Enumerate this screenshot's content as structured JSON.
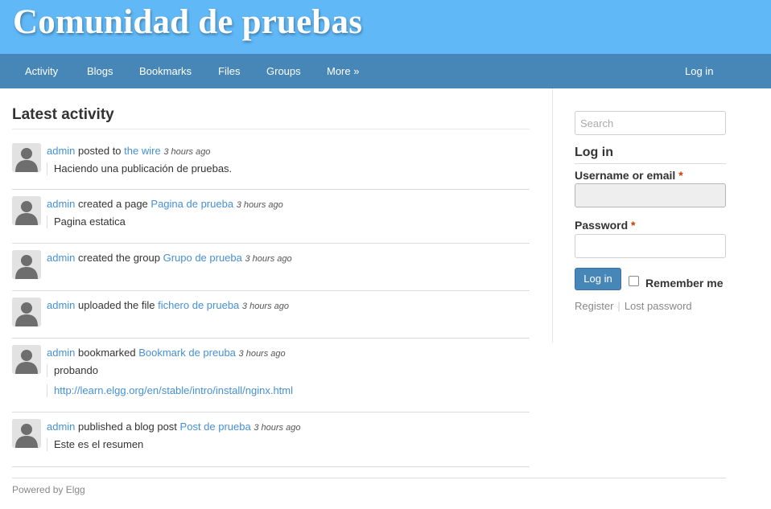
{
  "site": {
    "title": "Comunidad de pruebas"
  },
  "nav": {
    "items": [
      "Activity",
      "Blogs",
      "Bookmarks",
      "Files",
      "Groups",
      "More »"
    ],
    "login": "Log in"
  },
  "main": {
    "heading": "Latest activity"
  },
  "activity": [
    {
      "user": "admin",
      "action": "posted to",
      "target": "the wire",
      "time": "3 hours ago",
      "excerpt": "Haciendo una publicación de pruebas.",
      "link": ""
    },
    {
      "user": "admin",
      "action": "created a page",
      "target": "Pagina de prueba",
      "time": "3 hours ago",
      "excerpt": "Pagina estatica",
      "link": ""
    },
    {
      "user": "admin",
      "action": "created the group",
      "target": "Grupo de prueba",
      "time": "3 hours ago",
      "excerpt": "",
      "link": ""
    },
    {
      "user": "admin",
      "action": "uploaded the file",
      "target": "fichero de prueba",
      "time": "3 hours ago",
      "excerpt": "",
      "link": ""
    },
    {
      "user": "admin",
      "action": "bookmarked",
      "target": "Bookmark de preuba",
      "time": "3 hours ago",
      "excerpt": "probando",
      "link": "http://learn.elgg.org/en/stable/intro/install/nginx.html"
    },
    {
      "user": "admin",
      "action": "published a blog post",
      "target": "Post de prueba",
      "time": "3 hours ago",
      "excerpt": "Este es el resumen",
      "link": ""
    }
  ],
  "sidebar": {
    "search_placeholder": "Search",
    "login_title": "Log in",
    "username_label": "Username or email",
    "password_label": "Password",
    "required_mark": "*",
    "login_button": "Log in",
    "remember_label": "Remember me",
    "register": "Register",
    "separator": "|",
    "lost_password": "Lost password"
  },
  "footer": {
    "text": "Powered by Elgg"
  },
  "colors": {
    "header": "#60b8f7",
    "navbar": "#4787b8",
    "link": "#4690d6",
    "required": "#d33a00"
  }
}
